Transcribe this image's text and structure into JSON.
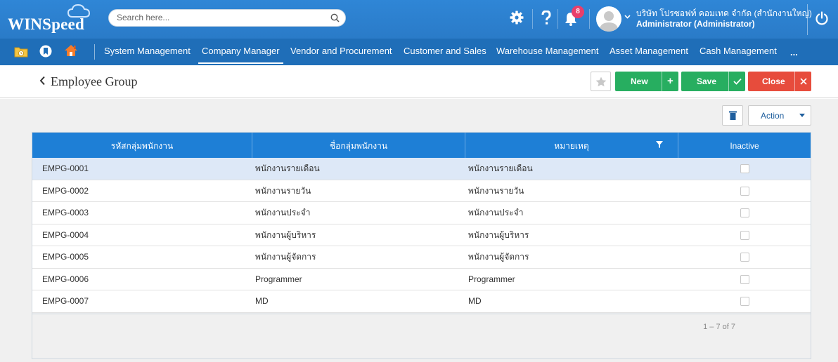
{
  "app": {
    "logo_text": "WINSpeed"
  },
  "header": {
    "search_placeholder": "Search here...",
    "notification_count": "8",
    "company_name": "บริษัท โปรซอฟท์ คอมเทค จำกัด (สำนักงานใหญ่)",
    "user_role": "Administrator (Administrator)"
  },
  "nav": {
    "items": [
      "System Management",
      "Company Manager",
      "Vendor and Procurement",
      "Customer and Sales",
      "Warehouse Management",
      "Asset Management",
      "Cash Management"
    ],
    "more": "...",
    "active_index": 1
  },
  "page": {
    "title": "Employee Group",
    "new_label": "New",
    "new_addon": "+",
    "save_label": "Save",
    "close_label": "Close"
  },
  "toolbar": {
    "action_label": "Action"
  },
  "table": {
    "columns": [
      "รหัสกลุ่มพนักงาน",
      "ชื่อกลุ่มพนักงาน",
      "หมายเหตุ",
      "Inactive"
    ],
    "rows": [
      {
        "code": "EMPG-0001",
        "name": "พนักงานรายเดือน",
        "note": "พนักงานรายเดือน",
        "inactive": false
      },
      {
        "code": "EMPG-0002",
        "name": "พนักงานรายวัน",
        "note": "พนักงานรายวัน",
        "inactive": false
      },
      {
        "code": "EMPG-0003",
        "name": "พนักงานประจำ",
        "note": "พนักงานประจำ",
        "inactive": false
      },
      {
        "code": "EMPG-0004",
        "name": "พนักงานผู้บริหาร",
        "note": "พนักงานผู้บริหาร",
        "inactive": false
      },
      {
        "code": "EMPG-0005",
        "name": "พนักงานผู้จัดการ",
        "note": "พนักงานผู้จัดการ",
        "inactive": false
      },
      {
        "code": "EMPG-0006",
        "name": "Programmer",
        "note": "Programmer",
        "inactive": false
      },
      {
        "code": "EMPG-0007",
        "name": "MD",
        "note": "MD",
        "inactive": false
      }
    ],
    "selected_row": 0,
    "pager_text": "1 – 7 of 7"
  },
  "colors": {
    "header_blue": "#2d7fcd",
    "nav_blue": "#1f6eb8",
    "table_head": "#1e7fd6",
    "success": "#27ae60",
    "danger": "#e74c3c",
    "badge": "#e83e6b"
  }
}
